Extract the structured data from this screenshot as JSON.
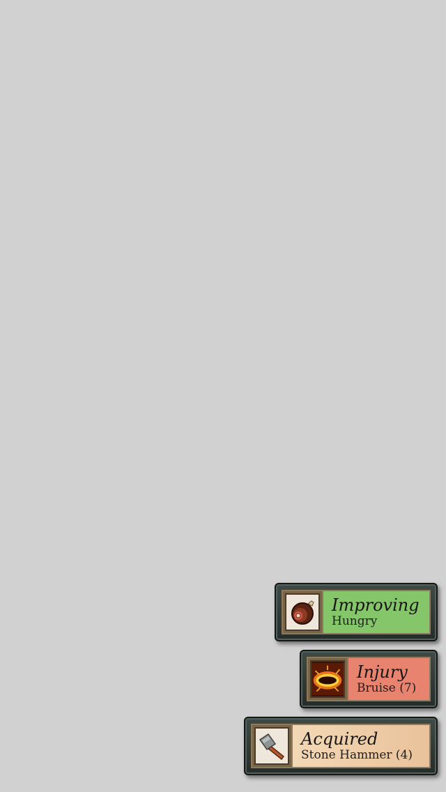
{
  "notifications": [
    {
      "title": "Improving",
      "subtitle": "Hungry",
      "icon": "meat-icon",
      "color": "#85c66a"
    },
    {
      "title": "Injury",
      "subtitle": "Bruise (7)",
      "icon": "bruise-icon",
      "color": "#e88370"
    },
    {
      "title": "Acquired",
      "subtitle": "Stone Hammer (4)",
      "icon": "hammer-icon",
      "color": "#efcfa8"
    }
  ]
}
